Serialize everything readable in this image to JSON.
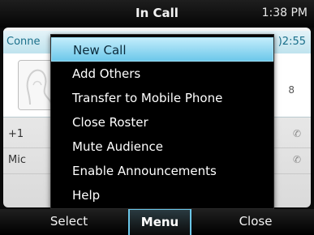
{
  "status_bar": {
    "title": "In Call",
    "time": "1:38 PM"
  },
  "call_panel": {
    "connection_label": "Conne",
    "duration": ")2:55",
    "card_icon": "8",
    "roster": [
      {
        "text": "+1",
        "icon": "phone-icon"
      },
      {
        "text": "Mic",
        "icon": "phone-icon"
      }
    ]
  },
  "menu": {
    "items": [
      {
        "label": "New Call",
        "selected": true
      },
      {
        "label": "Add Others",
        "selected": false
      },
      {
        "label": "Transfer to Mobile Phone",
        "selected": false
      },
      {
        "label": "Close Roster",
        "selected": false
      },
      {
        "label": "Mute Audience",
        "selected": false
      },
      {
        "label": "Enable Announcements",
        "selected": false
      },
      {
        "label": "Help",
        "selected": false
      }
    ]
  },
  "softkeys": {
    "left": "Select",
    "center": "Menu",
    "right": "Close"
  },
  "colors": {
    "accent": "#6cc8ea",
    "background": "#000000",
    "panel": "#e8e8e8"
  }
}
